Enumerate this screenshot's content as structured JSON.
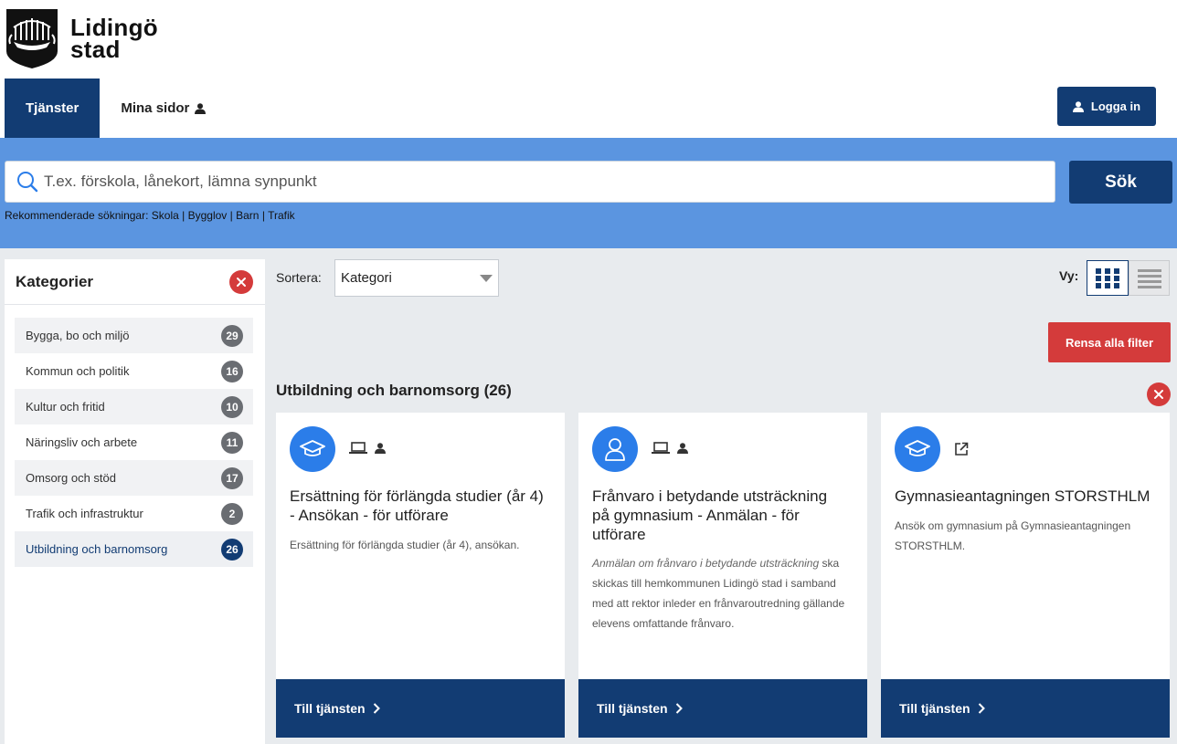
{
  "brand": {
    "line1": "Lidingö",
    "line2": "stad"
  },
  "nav": {
    "tab_services": "Tjänster",
    "tab_my_pages": "Mina sidor",
    "login": "Logga in"
  },
  "search": {
    "placeholder": "T.ex. förskola, lånekort, lämna synpunkt",
    "button": "Sök",
    "recommended_label": "Rekommenderade sökningar:",
    "recommended": [
      "Skola",
      "Bygglov",
      "Barn",
      "Trafik"
    ],
    "separator": "|"
  },
  "sidebar": {
    "title": "Kategorier",
    "items": [
      {
        "label": "Bygga, bo och miljö",
        "count": "29"
      },
      {
        "label": "Kommun och politik",
        "count": "16"
      },
      {
        "label": "Kultur och fritid",
        "count": "10"
      },
      {
        "label": "Näringsliv och arbete",
        "count": "11"
      },
      {
        "label": "Omsorg och stöd",
        "count": "17"
      },
      {
        "label": "Trafik och infrastruktur",
        "count": "2"
      },
      {
        "label": "Utbildning och barnomsorg",
        "count": "26"
      }
    ]
  },
  "toolbar": {
    "sort_label": "Sortera:",
    "sort_value": "Kategori",
    "view_label": "Vy:",
    "clear_filters": "Rensa alla filter"
  },
  "section": {
    "title": "Utbildning och barnomsorg (26)"
  },
  "cards": [
    {
      "icon": "graduation-cap-icon",
      "title": "Ersättning för förlängda studier (år 4) - Ansökan - för utförare",
      "desc_italic": "",
      "desc": "Ersättning för förlängda studier (år 4), ansökan.",
      "cta": "Till tjänsten"
    },
    {
      "icon": "person-icon",
      "title": "Frånvaro i betydande utsträckning på gymnasium - Anmälan - för utförare",
      "desc_italic": "Anmälan om frånvaro i betydande utsträckning",
      "desc": "ska skickas till hemkommunen Lidingö stad i samband med att rektor inleder en frånvaroutredning gällande elevens omfattande frånvaro.",
      "cta": "Till tjänsten"
    },
    {
      "icon": "graduation-cap-icon",
      "title": "Gymnasieantagningen STORSTHLM",
      "desc_italic": "",
      "desc": "Ansök om gymnasium på Gymnasieantagningen STORSTHLM.",
      "cta": "Till tjänsten"
    }
  ],
  "colors": {
    "primary": "#123c73",
    "accent_blue": "#5b95e0",
    "icon_blue": "#2b7de9",
    "danger": "#d43b3b"
  }
}
